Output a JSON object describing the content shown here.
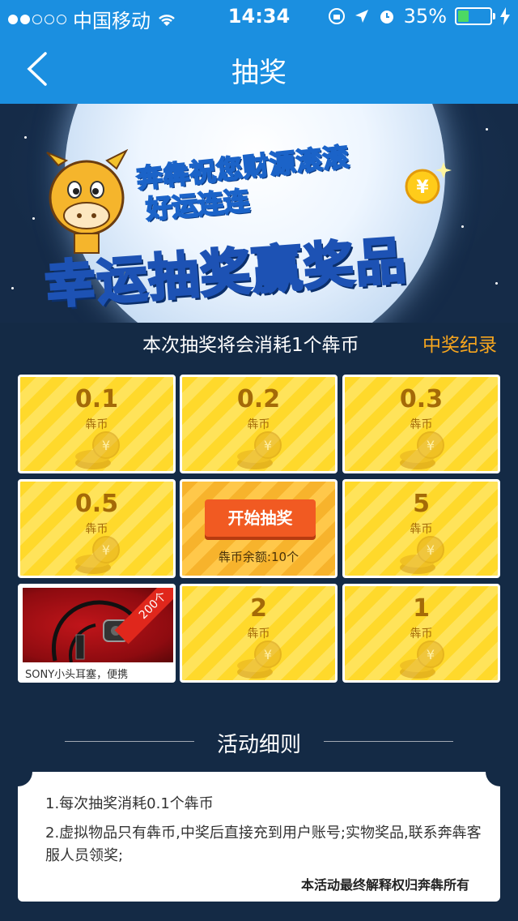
{
  "status": {
    "carrier": "中国移动",
    "time": "14:34",
    "battery": "35%",
    "battery_level": 0.35,
    "signal_bars_filled": 2,
    "signal_bars_total": 5
  },
  "nav": {
    "title": "抽奖",
    "back_icon": "chevron-left-icon"
  },
  "hero": {
    "slogan_line1": "奔犇祝您财源滚滚",
    "slogan_line2": "好运连连",
    "big_title_part1": "幸运抽奖",
    "big_title_part2": "赢奖品"
  },
  "info": {
    "cost_text": "本次抽奖将会消耗1个犇币",
    "record_link": "中奖纪录"
  },
  "prizes": [
    {
      "value": "0.1",
      "unit": "犇币"
    },
    {
      "value": "0.2",
      "unit": "犇币"
    },
    {
      "value": "0.3",
      "unit": "犇币"
    },
    {
      "value": "0.5",
      "unit": "犇币"
    },
    {
      "value": "5",
      "unit": "犇币"
    },
    {
      "value": "2",
      "unit": "犇币"
    },
    {
      "value": "1",
      "unit": "犇币"
    }
  ],
  "product": {
    "ribbon": "200个",
    "description": "SONY小头耳塞，便携"
  },
  "start": {
    "button_label": "开始抽奖",
    "balance": "犇币余额:10个"
  },
  "rules": {
    "title": "活动细则",
    "items": [
      "1.每次抽奖消耗0.1个犇币",
      "2.虚拟物品只有犇币,中奖后直接充到用户账号;实物奖品,联系奔犇客服人员领奖;"
    ],
    "footer": "本活动最终解释权归奔犇所有"
  },
  "colors": {
    "brand_blue": "#1b8fe0",
    "background": "#142a45",
    "accent_orange": "#f6a51e",
    "button_red": "#f15a22",
    "prize_yellow": "#ffd92b"
  }
}
